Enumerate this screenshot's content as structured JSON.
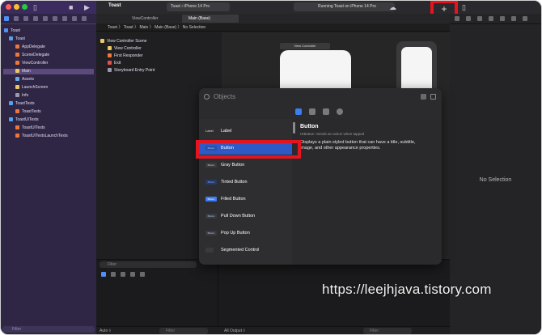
{
  "toolbar": {
    "project_title": "Toast",
    "scheme_target": "Toast",
    "scheme_device": "iPhone 14 Pro",
    "status_text": "Running Toast on iPhone 14 Pro",
    "add_label": "+"
  },
  "navigator": {
    "items": [
      {
        "label": "Toast",
        "indent": 0
      },
      {
        "label": "Toast",
        "indent": 1
      },
      {
        "label": "AppDelegate",
        "indent": 2
      },
      {
        "label": "SceneDelegate",
        "indent": 2
      },
      {
        "label": "ViewController",
        "indent": 2
      },
      {
        "label": "Main",
        "indent": 2,
        "selected": true
      },
      {
        "label": "Assets",
        "indent": 2
      },
      {
        "label": "LaunchScreen",
        "indent": 2
      },
      {
        "label": "Info",
        "indent": 2
      },
      {
        "label": "ToastTests",
        "indent": 1
      },
      {
        "label": "ToastTests",
        "indent": 2
      },
      {
        "label": "ToastUITests",
        "indent": 1
      },
      {
        "label": "ToastUITests",
        "indent": 2
      },
      {
        "label": "ToastUITestsLaunchTests",
        "indent": 2
      }
    ],
    "filter_placeholder": "Filter"
  },
  "editor": {
    "tabs": [
      "ViewController",
      "Main (Base)"
    ],
    "breadcrumb": "Toast 〉 Toast 〉 Main 〉 Main (Base) 〉 No Selection",
    "outline": [
      {
        "label": "View Controller Scene",
        "indent": 0
      },
      {
        "label": "View Controller",
        "indent": 1
      },
      {
        "label": "First Responder",
        "indent": 1
      },
      {
        "label": "Exit",
        "indent": 1
      },
      {
        "label": "Storyboard Entry Point",
        "indent": 1
      }
    ],
    "scene_title": "View Controller"
  },
  "inspector": {
    "empty_text": "No Selection"
  },
  "library": {
    "search_placeholder": "Objects",
    "items": [
      {
        "label": "Label",
        "thumb": "Label"
      },
      {
        "label": "Button",
        "thumb": "Button",
        "selected": true
      },
      {
        "label": "Gray Button",
        "thumb": "Button"
      },
      {
        "label": "Tinted Button",
        "thumb": "Button"
      },
      {
        "label": "Filled Button",
        "thumb": "Button"
      },
      {
        "label": "Pull Down Button",
        "thumb": "Button"
      },
      {
        "label": "Pop Up Button",
        "thumb": "Button"
      },
      {
        "label": "Segmented Control",
        "thumb": ""
      }
    ],
    "detail": {
      "title": "Button",
      "subtitle": "UIButton: Sends an action when tapped",
      "description": "Displays a plain styled button that can have a title, subtitle, image, and other appearance properties."
    }
  },
  "debug": {
    "filter_placeholder": "Filter",
    "auto_label": "Auto ◊",
    "output_label": "All Output ◊"
  },
  "watermark": "https://leejhjava.tistory.com",
  "colors": {
    "highlight": "#e5141e",
    "selection": "#2e5ac8",
    "sidebar": "#2f2544"
  }
}
